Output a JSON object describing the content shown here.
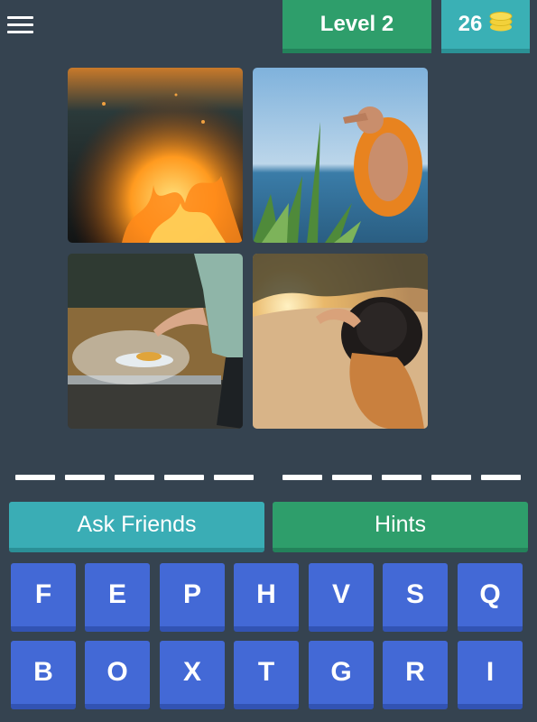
{
  "header": {
    "level_label": "Level 2",
    "coins": "26",
    "coin_color": "#f2d13a"
  },
  "images": [
    {
      "icon": "fire-image"
    },
    {
      "icon": "sun-shading-man-image"
    },
    {
      "icon": "steaming-food-image"
    },
    {
      "icon": "woman-in-sun-image"
    }
  ],
  "answer": {
    "word_lengths": [
      5,
      5
    ]
  },
  "actions": {
    "ask_friends": "Ask Friends",
    "hints": "Hints"
  },
  "keyboard": {
    "row1": [
      "F",
      "E",
      "P",
      "H",
      "V",
      "S",
      "Q"
    ],
    "row2": [
      "B",
      "O",
      "X",
      "T",
      "G",
      "R",
      "I"
    ]
  },
  "colors": {
    "background": "#354350",
    "level_green": "#2e9e6b",
    "teal": "#3ab0b5",
    "key_blue": "#4369d6"
  }
}
